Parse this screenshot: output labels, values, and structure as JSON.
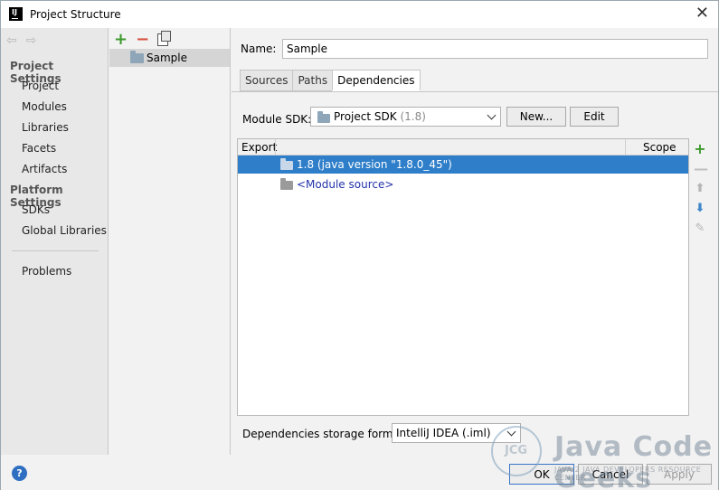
{
  "window": {
    "title": "Project Structure",
    "app_icon_text": "IJ",
    "close_glyph": "✕"
  },
  "nav": {
    "back_glyph": "⇦",
    "forward_glyph": "⇨",
    "project_settings_heading": "Project Settings",
    "project_settings_items": [
      "Project",
      "Modules",
      "Libraries",
      "Facets",
      "Artifacts"
    ],
    "platform_settings_heading": "Platform Settings",
    "platform_settings_items": [
      "SDKs",
      "Global Libraries"
    ],
    "problems": "Problems"
  },
  "modules": {
    "add_glyph": "+",
    "remove_glyph": "−",
    "items": [
      "Sample"
    ]
  },
  "detail": {
    "name_label": "Name:",
    "name_value": "Sample",
    "tabs": [
      "Sources",
      "Paths",
      "Dependencies"
    ],
    "active_tab": "Dependencies",
    "module_sdk_label": "Module SDK:",
    "module_sdk_value": "Project SDK",
    "module_sdk_version": "(1.8)",
    "new_button": "New...",
    "edit_button": "Edit",
    "table": {
      "col_export": "Export",
      "col_scope": "Scope",
      "rows": [
        {
          "label": "1.8 (java version \"1.8.0_45\")",
          "selected": true
        },
        {
          "label": "<Module source>",
          "selected": false
        }
      ]
    },
    "side_tools": {
      "add": "+",
      "remove": "—",
      "up": "⬆",
      "down": "⬇",
      "edit": "✎"
    },
    "storage_label": "Dependencies storage format:",
    "storage_value": "IntelliJ IDEA (.iml)"
  },
  "footer": {
    "help": "?",
    "ok": "OK",
    "cancel": "Cancel",
    "apply": "Apply"
  },
  "watermark": {
    "mark": "JCG",
    "brand": "Java Code Geeks",
    "tagline": "JAVA 2 JAVA DEVELOPERS RESOURCE CENTER"
  },
  "colors": {
    "selection": "#2e7ec9",
    "add_green": "#3d9a2d",
    "remove_red": "#d9503f",
    "link_blue": "#2233aa"
  }
}
